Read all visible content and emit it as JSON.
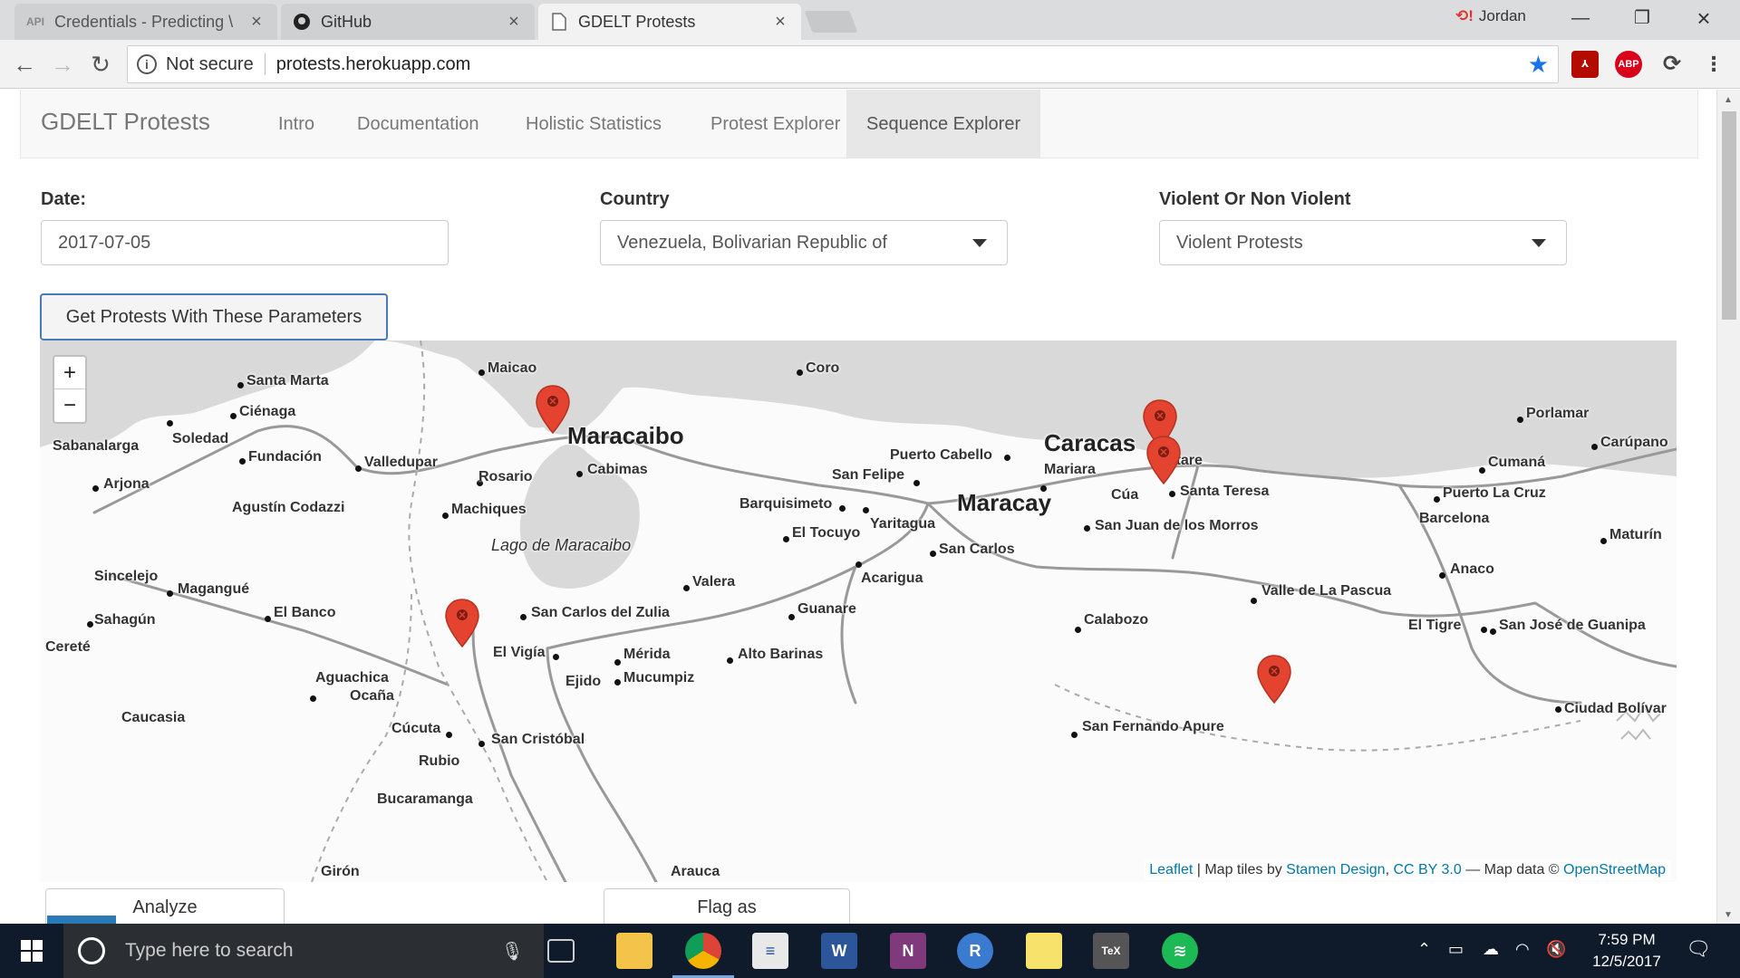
{
  "browser": {
    "tabs": [
      {
        "title": "Credentials - Predicting \\",
        "favicon": "API",
        "active": false
      },
      {
        "title": "GitHub",
        "favicon": "github-icon",
        "active": false
      },
      {
        "title": "GDELT Protests",
        "favicon": "page-icon",
        "active": true
      }
    ],
    "profile_name": "Jordan",
    "security_label": "Not secure",
    "url": "protests.herokuapp.com",
    "extensions": [
      "adobe-icon",
      "adblock-plus-icon",
      "sync-icon"
    ],
    "ext_abp_label": "ABP"
  },
  "navbar": {
    "brand": "GDELT Protests",
    "links": [
      {
        "label": "Intro"
      },
      {
        "label": "Documentation"
      },
      {
        "label": "Holistic Statistics"
      },
      {
        "label": "Protest Explorer"
      },
      {
        "label": "Sequence Explorer",
        "active": true
      }
    ]
  },
  "form": {
    "date_label": "Date:",
    "date_value": "2017-07-05",
    "country_label": "Country",
    "country_value": "Venezuela, Bolivarian Republic of",
    "violence_label": "Violent Or Non Violent",
    "violence_value": "Violent Protests",
    "submit_label": "Get Protests With These Parameters"
  },
  "map": {
    "zoom_in": "+",
    "zoom_out": "−",
    "big_cities": [
      "Maracaibo",
      "Caracas",
      "Maracay"
    ],
    "cities": [
      "Santa Marta",
      "Maicao",
      "Coro",
      "Ciénaga",
      "Soledad",
      "Sabanalarga",
      "Fundación",
      "Valledupar",
      "Arjona",
      "Agustín Codazzi",
      "Rosario",
      "Cabimas",
      "Machiques",
      "Sincelejo",
      "Magangué",
      "Sahagún",
      "El Banco",
      "Cereté",
      "San Carlos del Zulia",
      "El Vigía",
      "Mérida",
      "Ejido",
      "Mucumpiz",
      "Alto Barinas",
      "Aguachica",
      "Ocaña",
      "Caucasia",
      "Cúcuta",
      "San Cristóbal",
      "Rubio",
      "Bucaramanga",
      "Puerto Cabello",
      "San Felipe",
      "Barquisimeto",
      "Yaritagua",
      "El Tocuyo",
      "Acarigua",
      "San Carlos",
      "Valera",
      "Guanare",
      "Mariara",
      "Petare",
      "Santa Teresa",
      "Cúa",
      "San Juan de los Morros",
      "Calabozo",
      "Valle de La Pascua",
      "San Fernando Apure",
      "Porlamar",
      "Carúpano",
      "Cumaná",
      "Puerto La Cruz",
      "Barcelona",
      "Maturín",
      "Anaco",
      "El Tigre",
      "San José de Guanipa",
      "Ciudad Bolívar",
      "Girón",
      "Arauca"
    ],
    "lake_label": "Lago de Maracaibo",
    "attribution": {
      "leaflet": "Leaflet",
      "tiles_prefix": "| Map tiles by",
      "stamen": "Stamen Design",
      "license": "CC BY 3.0",
      "data_prefix": "— Map data ©",
      "osm": "OpenStreetMap"
    },
    "markers": [
      {
        "name": "Maracaibo"
      },
      {
        "name": "Caracas"
      },
      {
        "name": "Cúa"
      },
      {
        "name": "El Vigía"
      },
      {
        "name": "San Fernando Apure"
      }
    ],
    "marker_color": "#e3432f"
  },
  "lower": {
    "analyze_label": "Analyze",
    "flag_label": "Flag as"
  },
  "taskbar": {
    "search_placeholder": "Type here to search",
    "time": "7:59 PM",
    "date": "12/5/2017"
  }
}
